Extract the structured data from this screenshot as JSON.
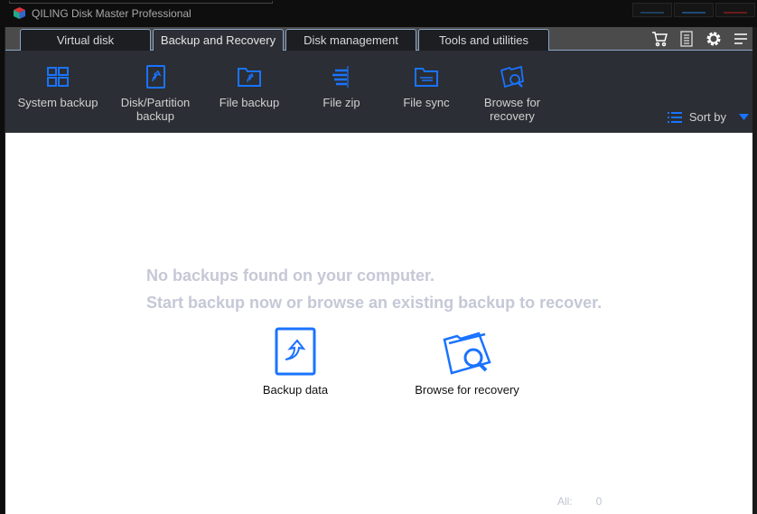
{
  "app": {
    "title": "QILING Disk Master Professional"
  },
  "tabs": [
    {
      "label": "Virtual disk"
    },
    {
      "label": "Backup and Recovery"
    },
    {
      "label": "Disk management"
    },
    {
      "label": "Tools and utilities"
    }
  ],
  "toolbar": {
    "items": [
      {
        "label": "System backup"
      },
      {
        "label": "Disk/Partition backup"
      },
      {
        "label": "File backup"
      },
      {
        "label": "File zip"
      },
      {
        "label": "File sync"
      },
      {
        "label": "Browse for recovery"
      }
    ],
    "sort_label": "Sort by"
  },
  "content": {
    "line1": "No backups found on your computer.",
    "line2": "Start backup now or browse an existing backup to recover.",
    "backup_data": "Backup data",
    "browse_recovery": "Browse for recovery",
    "all_label": "All:",
    "all_count": "0"
  },
  "colors": {
    "accent": "#1a73ff",
    "toolbar": "#2b2e34"
  }
}
